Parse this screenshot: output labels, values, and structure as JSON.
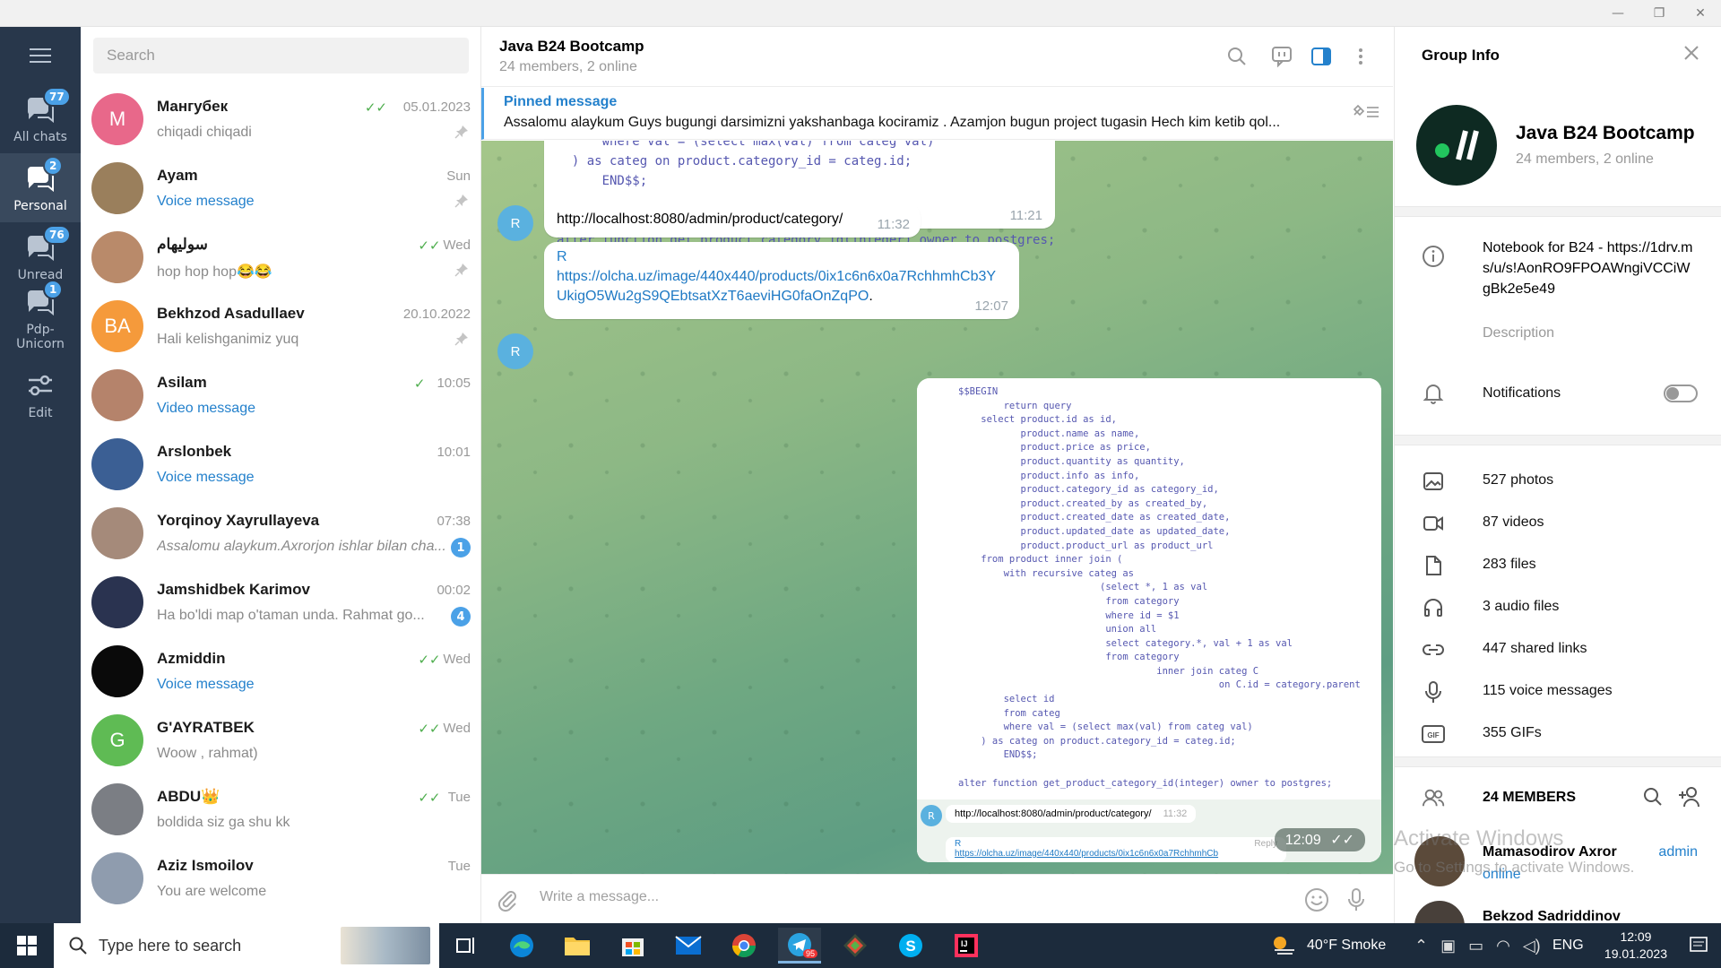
{
  "window": {
    "minimize": "—",
    "maximize": "❐",
    "close": "✕"
  },
  "rail": {
    "menu_icon": "hamburger-icon",
    "items": [
      {
        "label": "All chats",
        "badge": "77",
        "active": false
      },
      {
        "label": "Personal",
        "badge": "2",
        "active": true
      },
      {
        "label": "Unread",
        "badge": "76",
        "active": false
      },
      {
        "label": "Pdp-\nUnicorn",
        "badge": "1",
        "active": false
      },
      {
        "label": "Edit",
        "badge": "",
        "active": false
      }
    ]
  },
  "chatlist": {
    "search_placeholder": "Search",
    "chats": [
      {
        "name": "Мангубек",
        "time": "05.01.2023",
        "preview": "chiqadi chiqadi",
        "avatar_letter": "M",
        "avatar_color": "#e8688a",
        "checks": "✓✓",
        "pinned": true,
        "preview_style": "normal",
        "badge": ""
      },
      {
        "name": "Ayam",
        "time": "Sun",
        "preview": "Voice message",
        "avatar_letter": "",
        "avatar_color": "#9a7f5c",
        "checks": "",
        "pinned": true,
        "preview_style": "blue",
        "badge": ""
      },
      {
        "name": "سوليهام",
        "time": "Wed",
        "preview": "hop hop hop😂😂",
        "avatar_letter": "",
        "avatar_color": "#b98a6a",
        "checks": "✓✓",
        "pinned": true,
        "preview_style": "normal",
        "badge": ""
      },
      {
        "name": "Bekhzod Asadullaev",
        "time": "20.10.2022",
        "preview": "Hali kelishganimiz yuq",
        "avatar_letter": "BA",
        "avatar_color": "#f59a3b",
        "checks": "",
        "pinned": true,
        "preview_style": "normal",
        "badge": ""
      },
      {
        "name": "Asilam",
        "time": "10:05",
        "preview": "Video message",
        "avatar_letter": "",
        "avatar_color": "#b5836b",
        "checks": "✓",
        "pinned": false,
        "preview_style": "blue",
        "badge": ""
      },
      {
        "name": "Arslonbek",
        "time": "10:01",
        "preview": "Voice message",
        "avatar_letter": "",
        "avatar_color": "#3b5f94",
        "checks": "",
        "pinned": false,
        "preview_style": "blue",
        "badge": ""
      },
      {
        "name": "Yorqinoy Xayrullayeva",
        "time": "07:38",
        "preview": "Assalomu alaykum.Axrorjon ishlar bilan cha...",
        "avatar_letter": "",
        "avatar_color": "#a58a7a",
        "checks": "",
        "pinned": false,
        "preview_style": "italic",
        "badge": "1"
      },
      {
        "name": "Jamshidbek Karimov",
        "time": "00:02",
        "preview": "Ha bo'ldi map o'taman unda. Rahmat go...",
        "avatar_letter": "",
        "avatar_color": "#2a3350",
        "checks": "",
        "pinned": false,
        "preview_style": "normal",
        "badge": "4"
      },
      {
        "name": "Azmiddin",
        "time": "Wed",
        "preview": "Voice message",
        "avatar_letter": "",
        "avatar_color": "#0a0a0a",
        "checks": "✓✓",
        "pinned": false,
        "preview_style": "blue",
        "badge": ""
      },
      {
        "name": "G'AYRATBEK",
        "time": "Wed",
        "preview": "Woow , rahmat)",
        "avatar_letter": "G",
        "avatar_color": "#5fbb54",
        "checks": "✓✓",
        "pinned": false,
        "preview_style": "normal",
        "badge": ""
      },
      {
        "name": "ABDU👑",
        "time": "Tue",
        "preview": "boldida siz ga shu kk",
        "avatar_letter": "",
        "avatar_color": "#7b7e84",
        "checks": "✓✓",
        "pinned": false,
        "preview_style": "normal",
        "badge": ""
      },
      {
        "name": "Aziz Ismoilov",
        "time": "Tue",
        "preview": "You are welcome",
        "avatar_letter": "",
        "avatar_color": "#8f9cae",
        "checks": "",
        "pinned": false,
        "preview_style": "normal",
        "badge": ""
      }
    ]
  },
  "header": {
    "title": "Java B24 Bootcamp",
    "subtitle": "24 members, 2 online"
  },
  "pinned": {
    "title": "Pinned message",
    "text": "Assalomu alaykum Guys bugungi darsimizni yakshanbaga kociramiz . Azamjon bugun project tugasin Hech kim ketib qol..."
  },
  "messages": {
    "code_tail": "      where val = (select max(val) from categ val)\n  ) as categ on product.category_id = categ.id;\n      END$$;\n\n\nalter function get_product_category_id(integer) owner to postgres;",
    "code_time": "11:21",
    "link_msg": {
      "avatar": "R",
      "text": "http://localhost:8080/admin/product/category/",
      "time": "11:32"
    },
    "url_msg": {
      "avatar": "R",
      "sender": "R",
      "url": "https://olcha.uz/image/440x440/products/0ix1c6n6x0a7RchhmhCb3YUkigO5Wu2gS9QEbtsatXzT6aeviHG0faOnZqPO",
      "tail": ".",
      "time": "12:07"
    },
    "image_msg": {
      "code": "$$BEGIN\n        return query\n    select product.id as id,\n           product.name as name,\n           product.price as price,\n           product.quantity as quantity,\n           product.info as info,\n           product.category_id as category_id,\n           product.created_by as created_by,\n           product.created_date as created_date,\n           product.updated_date as updated_date,\n           product.product_url as product_url\n    from product inner join (\n        with recursive categ as\n                         (select *, 1 as val\n                          from category\n                          where id = $1\n                          union all\n                          select category.*, val + 1 as val\n                          from category\n                                   inner join categ C\n                                              on C.id = category.parent\n        select id\n        from categ\n        where val = (select max(val) from categ val)\n    ) as categ on product.category_id = categ.id;\n        END$$;\n\nalter function get_product_category_id(integer) owner to postgres;",
      "inner_link": "http://localhost:8080/admin/product/category/",
      "inner_link_time": "11:32",
      "inner_sender": "R",
      "inner_url": "https://olcha.uz/image/440x440/products/0ix1c6n6x0a7RchhmhCb",
      "inner_reply": "Reply",
      "time": "12:09",
      "checks": "✓✓"
    }
  },
  "composer": {
    "placeholder": "Write a message..."
  },
  "info": {
    "title": "Group Info",
    "group_name": "Java B24 Bootcamp",
    "group_sub": "24 members, 2 online",
    "description": "Notebook for B24 - https://1drv.ms/u/s!AonRO9FPOAWngiVCCiWgBk2e5e49",
    "description_label": "Description",
    "notifications": "Notifications",
    "notifications_on": false,
    "media": [
      {
        "icon": "photo-icon",
        "label": "527 photos"
      },
      {
        "icon": "video-icon",
        "label": "87 videos"
      },
      {
        "icon": "file-icon",
        "label": "283 files"
      },
      {
        "icon": "headphones-icon",
        "label": "3 audio files"
      },
      {
        "icon": "link-icon",
        "label": "447 shared links"
      },
      {
        "icon": "microphone-icon",
        "label": "115 voice messages"
      },
      {
        "icon": "gif-icon",
        "label": "355 GIFs"
      }
    ],
    "members_head": "24 MEMBERS",
    "members": [
      {
        "name": "Mamasodirov Axror",
        "status": "online",
        "role": "admin"
      },
      {
        "name": "Bekzod Sadriddinov",
        "status": "",
        "role": ""
      }
    ]
  },
  "watermark": {
    "line1": "Activate Windows",
    "line2": "Go to Settings to activate Windows."
  },
  "taskbar": {
    "search_placeholder": "Type here to search",
    "weather": "40°F  Smoke",
    "lang": "ENG",
    "time": "12:09",
    "date": "19.01.2023",
    "telegram_badge": "95"
  }
}
